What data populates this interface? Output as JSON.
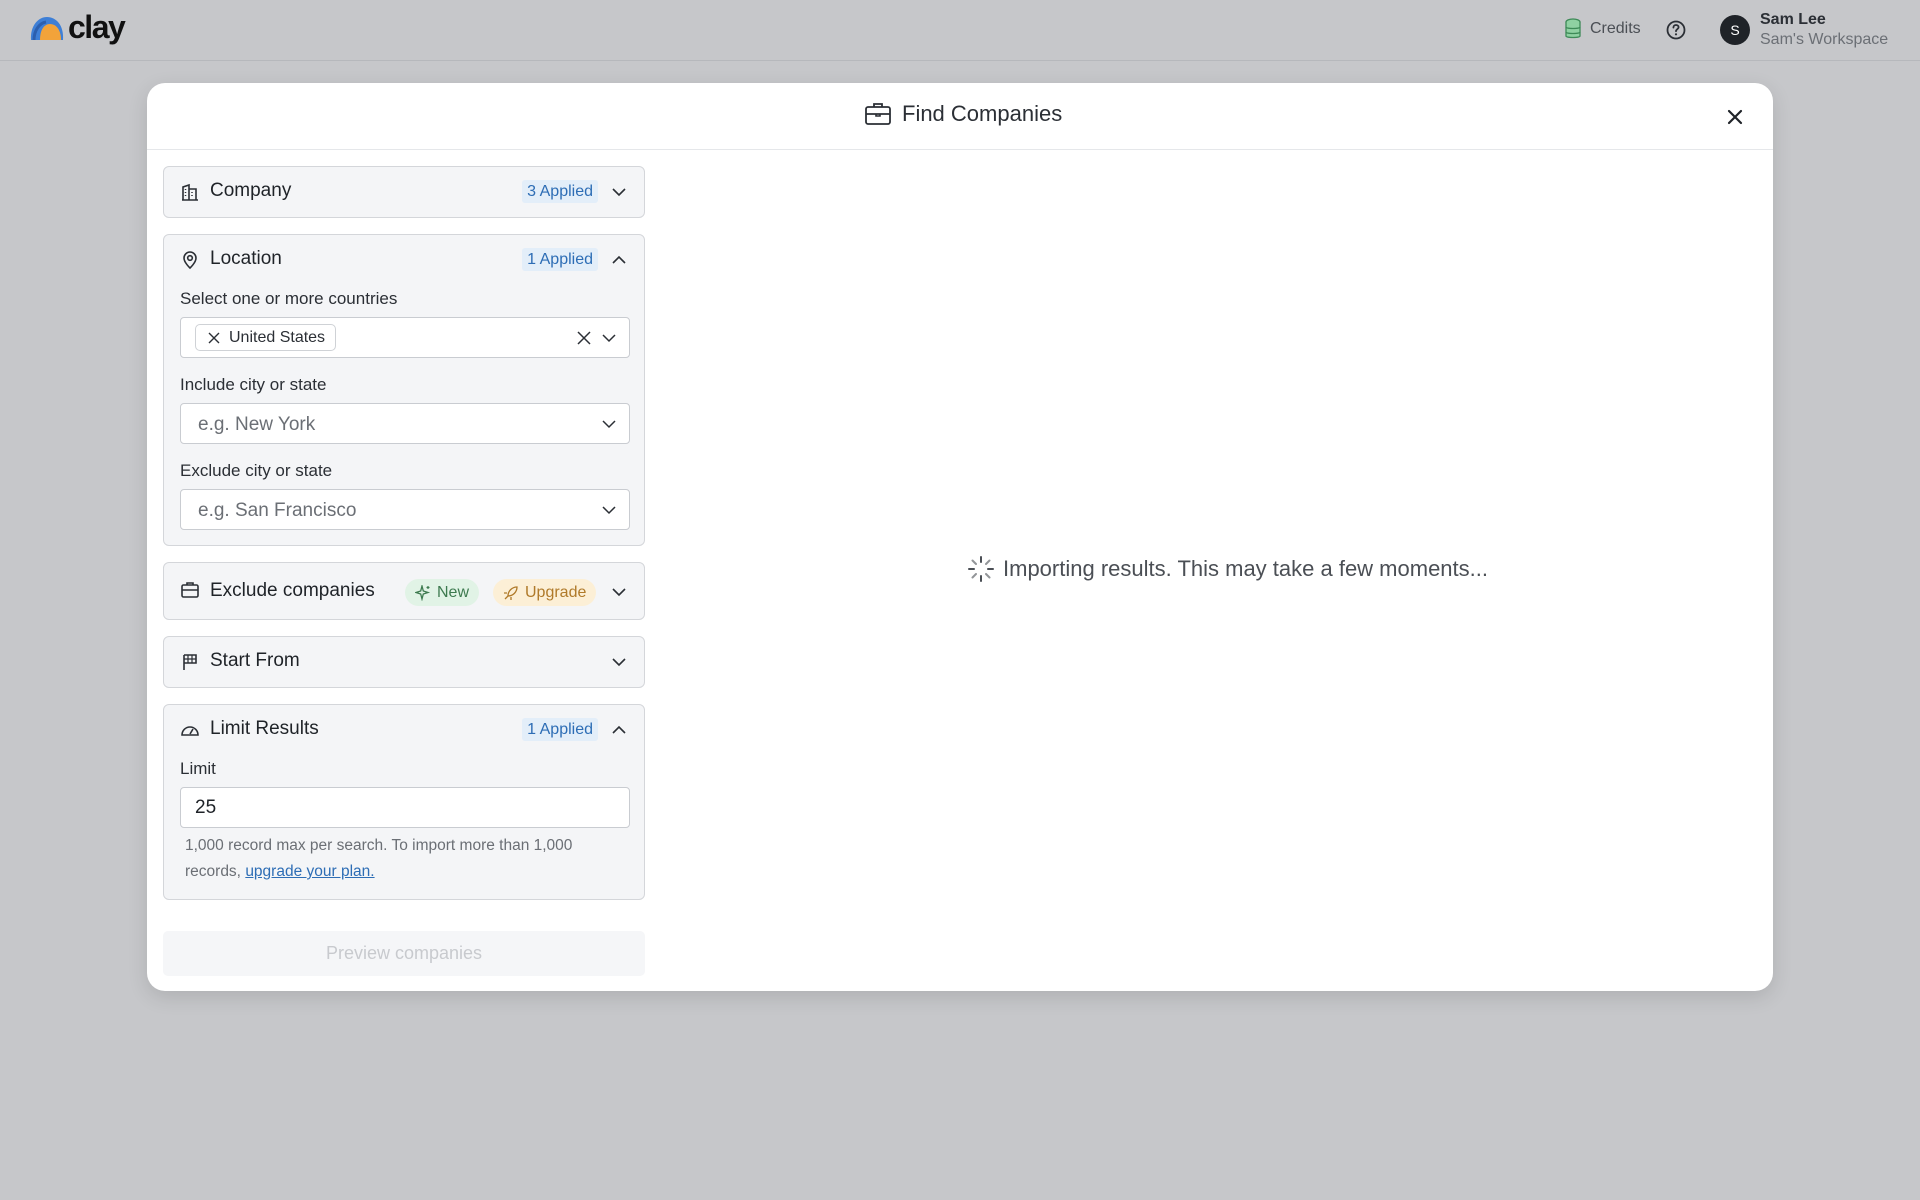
{
  "topbar": {
    "logo_text": "clay",
    "credits_label": "Credits",
    "user": {
      "initial": "S",
      "name": "Sam Lee",
      "workspace": "Sam's Workspace"
    }
  },
  "modal": {
    "title": "Find Companies",
    "sections": {
      "company": {
        "title": "Company",
        "badge": "3 Applied"
      },
      "location": {
        "title": "Location",
        "badge": "1 Applied",
        "countries_label": "Select one or more countries",
        "selected_country": "United States",
        "include_label": "Include city or state",
        "include_placeholder": "e.g. New York",
        "exclude_label": "Exclude city or state",
        "exclude_placeholder": "e.g. San Francisco"
      },
      "exclude_companies": {
        "title": "Exclude companies",
        "new_badge": "New",
        "upgrade_badge": "Upgrade"
      },
      "start_from": {
        "title": "Start From"
      },
      "limit": {
        "title": "Limit Results",
        "badge": "1 Applied",
        "field_label": "Limit",
        "value": "25",
        "note": "1,000 record max per search. To import more than 1,000 records, ",
        "note_link": "upgrade your plan."
      }
    },
    "preview_button": "Preview companies",
    "loading_text": "Importing results. This may take a few moments..."
  },
  "colors": {
    "accent_blue": "#2d6db5",
    "badge_bg": "#e3eef9",
    "new_green": "#3d7a4f",
    "upgrade_orange": "#b07a2a"
  }
}
